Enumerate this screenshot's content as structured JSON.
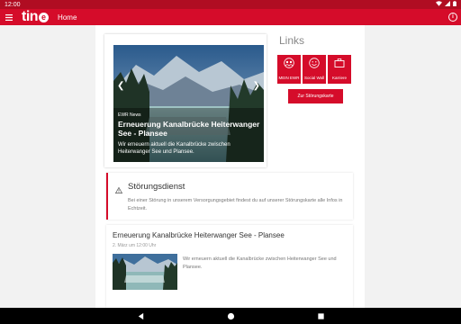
{
  "status_bar": {
    "time": "12:00"
  },
  "app_bar": {
    "logo_text": "tin",
    "logo_mark": "e",
    "title": "Home"
  },
  "hero": {
    "source": "EWR News",
    "title": "Erneuerung Kanalbrücke Heiterwanger See - Plansee",
    "description": "Wir erneuern aktuell die Kanalbrücke zwischen Heiterwanger See und Plansee."
  },
  "links": {
    "heading": "Links",
    "tiles": [
      {
        "label": "MEIN EWR",
        "icon": "people-icon"
      },
      {
        "label": "Social Wall",
        "icon": "smiley-icon"
      },
      {
        "label": "Karriere",
        "icon": "briefcase-icon"
      }
    ],
    "map_button": "Zur Störungskarte"
  },
  "alert": {
    "icon": "warning-icon",
    "title": "Störungsdienst",
    "text": "Bei einer Störung in unserem Versorgungsgebiet findest du auf unserer Störungskarte alle Infos in Echtzeit."
  },
  "news": {
    "title": "Erneuerung Kanalbrücke Heiterwanger See - Plansee",
    "date": "2. März um 12:00 Uhr",
    "text": "Wir erneuern aktuell die Kanalbrücke zwischen Heiterwanger See und Plansee."
  },
  "colors": {
    "brand": "#d50c2a",
    "status_bar": "#b00d22",
    "background": "#f2f2f2"
  }
}
